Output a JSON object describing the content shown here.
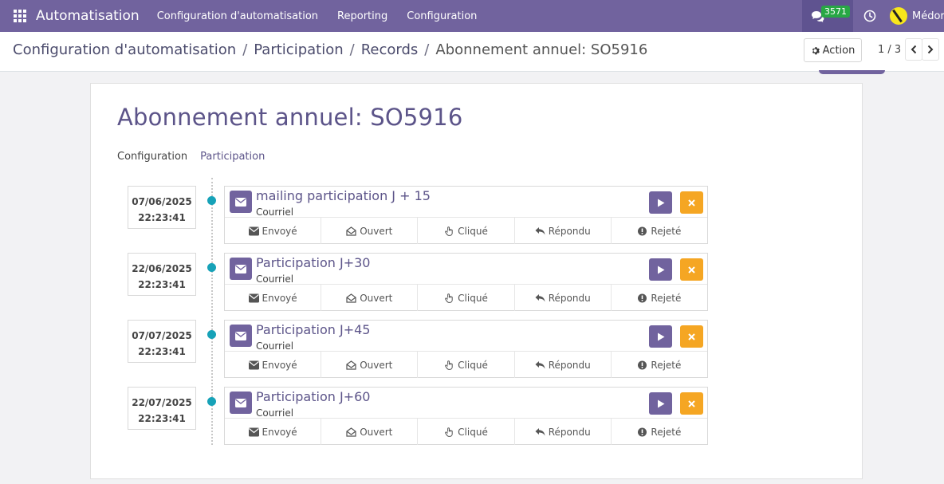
{
  "navbar": {
    "app_name": "Automatisation",
    "menu": [
      "Configuration d'automatisation",
      "Reporting",
      "Configuration"
    ],
    "chat_count": "3571",
    "user_name": "Médor"
  },
  "breadcrumb": {
    "items": [
      "Configuration d'automatisation",
      "Participation",
      "Records"
    ],
    "current": "Abonnement annuel: SO5916"
  },
  "toolbar": {
    "action_label": "Action",
    "pager": "1 / 3"
  },
  "record": {
    "title": "Abonnement annuel: SO5916",
    "tabs": [
      "Configuration",
      "Participation"
    ],
    "active_tab": "Participation"
  },
  "stat_labels": [
    "Envoyé",
    "Ouvert",
    "Cliqué",
    "Répondu",
    "Rejeté"
  ],
  "activities": [
    {
      "date": "07/06/2025",
      "time": "22:23:41",
      "title": "mailing participation J + 15",
      "type": "Courriel"
    },
    {
      "date": "22/06/2025",
      "time": "22:23:41",
      "title": "Participation J+30",
      "type": "Courriel"
    },
    {
      "date": "07/07/2025",
      "time": "22:23:41",
      "title": "Participation J+45",
      "type": "Courriel"
    },
    {
      "date": "22/07/2025",
      "time": "22:23:41",
      "title": "Participation J+60",
      "type": "Courriel"
    }
  ],
  "colors": {
    "brand": "#71639e",
    "timeline_dot": "#17a2b8",
    "cancel": "#f5a623",
    "badge": "#28a745"
  }
}
